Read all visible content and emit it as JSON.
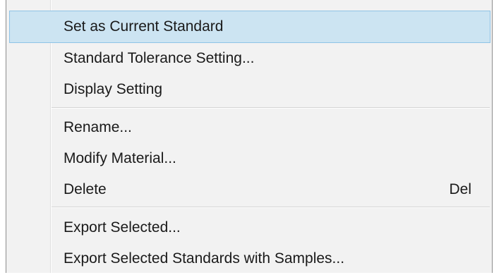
{
  "menu": {
    "items": [
      {
        "label": "Set as Current Standard",
        "shortcut": ""
      },
      {
        "label": "Standard Tolerance Setting...",
        "shortcut": ""
      },
      {
        "label": "Display Setting",
        "shortcut": ""
      },
      {
        "label": "Rename...",
        "shortcut": ""
      },
      {
        "label": "Modify Material...",
        "shortcut": ""
      },
      {
        "label": "Delete",
        "shortcut": "Del"
      },
      {
        "label": "Export Selected...",
        "shortcut": ""
      },
      {
        "label": "Export Selected Standards with Samples...",
        "shortcut": ""
      }
    ],
    "highlighted_item": "Set as Current Standard"
  }
}
